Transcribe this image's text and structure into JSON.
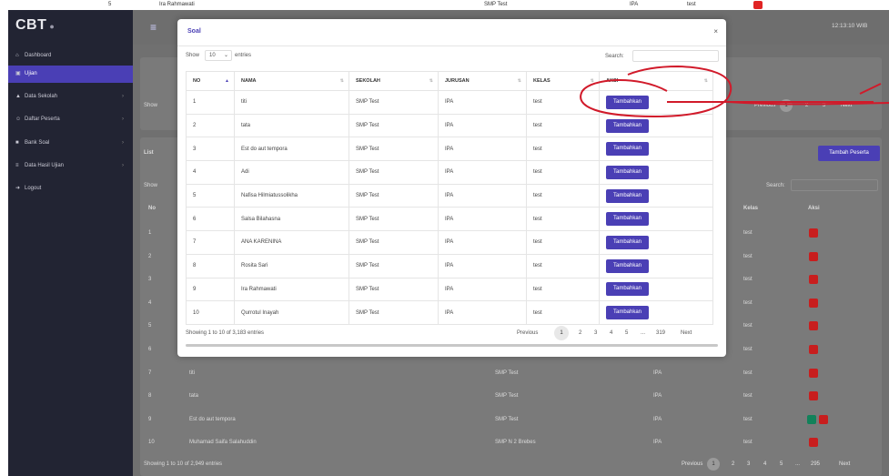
{
  "top_strip": {
    "no": "5",
    "name": "Ira Rahmawati",
    "school": "SMP Test",
    "major": "IPA",
    "class": "test"
  },
  "app": {
    "logo": "CBT",
    "time": "12:13:10 WIB"
  },
  "sidebar": {
    "items": [
      {
        "label": "Dashboard",
        "icon": "home-icon"
      },
      {
        "label": "Ujian",
        "icon": "calendar-icon",
        "active": true
      },
      {
        "label": "Data Sekolah",
        "icon": "school-icon",
        "has_arrow": true
      },
      {
        "label": "Daftar Peserta",
        "icon": "user-icon",
        "has_arrow": true
      },
      {
        "label": "Bank Soal",
        "icon": "server-icon",
        "has_arrow": true
      },
      {
        "label": "Data Hasil Ujian",
        "icon": "list-icon",
        "has_arrow": true
      },
      {
        "label": "Logout",
        "icon": "logout-icon"
      }
    ]
  },
  "background": {
    "top_card": {
      "show": "Show",
      "pagination": [
        "Previous",
        "1",
        "2",
        "3",
        "Next"
      ]
    },
    "list_card": {
      "title": "List",
      "add_button": "Tambah Peserta",
      "show": "Show",
      "search": "Search:",
      "col_no": "No",
      "col_kelas": "Kelas",
      "col_aksi": "Aksi",
      "rows": [
        {
          "no": "1",
          "name": "",
          "school": "",
          "major": "",
          "kelas": "test",
          "green": false
        },
        {
          "no": "2",
          "name": "",
          "school": "",
          "major": "",
          "kelas": "test",
          "green": false
        },
        {
          "no": "3",
          "name": "",
          "school": "",
          "major": "",
          "kelas": "test",
          "green": false
        },
        {
          "no": "4",
          "name": "",
          "school": "",
          "major": "",
          "kelas": "test",
          "green": false
        },
        {
          "no": "5",
          "name": "",
          "school": "",
          "major": "",
          "kelas": "test",
          "green": false
        },
        {
          "no": "6",
          "name": "",
          "school": "",
          "major": "",
          "kelas": "test",
          "green": false
        },
        {
          "no": "7",
          "name": "titi",
          "school": "SMP Test",
          "major": "IPA",
          "kelas": "test",
          "green": false
        },
        {
          "no": "8",
          "name": "tata",
          "school": "SMP Test",
          "major": "IPA",
          "kelas": "test",
          "green": false
        },
        {
          "no": "9",
          "name": "Est do aut tempora",
          "school": "SMP Test",
          "major": "IPA",
          "kelas": "test",
          "green": true
        },
        {
          "no": "10",
          "name": "Muhamad Saifa Salahuddin",
          "school": "SMP N 2 Brebes",
          "major": "IPA",
          "kelas": "test",
          "green": false
        }
      ],
      "info": "Showing 1 to 10 of 2,949 entries",
      "pagination": [
        "Previous",
        "1",
        "2",
        "3",
        "4",
        "5",
        "...",
        "295",
        "Next"
      ]
    }
  },
  "modal": {
    "title": "Soal",
    "close": "×",
    "show_label": "Show",
    "show_value": "10",
    "entries_label": "entries",
    "search_label": "Search:",
    "search_value": "",
    "columns": [
      "NO",
      "NAMA",
      "SEKOLAH",
      "JURUSAN",
      "KELAS",
      "AKSI"
    ],
    "rows": [
      {
        "no": "1",
        "name": "titi",
        "school": "SMP Test",
        "major": "IPA",
        "kelas": "test",
        "action": "Tambahkan"
      },
      {
        "no": "2",
        "name": "tata",
        "school": "SMP Test",
        "major": "IPA",
        "kelas": "test",
        "action": "Tambahkan"
      },
      {
        "no": "3",
        "name": "Est do aut tempora",
        "school": "SMP Test",
        "major": "IPA",
        "kelas": "test",
        "action": "Tambahkan"
      },
      {
        "no": "4",
        "name": "Adi",
        "school": "SMP Test",
        "major": "IPA",
        "kelas": "test",
        "action": "Tambahkan"
      },
      {
        "no": "5",
        "name": "Nafisa Hilmiatussolikha",
        "school": "SMP Test",
        "major": "IPA",
        "kelas": "test",
        "action": "Tambahkan"
      },
      {
        "no": "6",
        "name": "Salsa Bilahasna",
        "school": "SMP Test",
        "major": "IPA",
        "kelas": "test",
        "action": "Tambahkan"
      },
      {
        "no": "7",
        "name": "ANA KARENINA",
        "school": "SMP Test",
        "major": "IPA",
        "kelas": "test",
        "action": "Tambahkan"
      },
      {
        "no": "8",
        "name": "Rosita Sari",
        "school": "SMP Test",
        "major": "IPA",
        "kelas": "test",
        "action": "Tambahkan"
      },
      {
        "no": "9",
        "name": "Ira Rahmawati",
        "school": "SMP Test",
        "major": "IPA",
        "kelas": "test",
        "action": "Tambahkan"
      },
      {
        "no": "10",
        "name": "Qurrotul Inayah",
        "school": "SMP Test",
        "major": "IPA",
        "kelas": "test",
        "action": "Tambahkan"
      }
    ],
    "info": "Showing 1 to 10 of 3,183 entries",
    "pagination": [
      "Previous",
      "1",
      "2",
      "3",
      "4",
      "5",
      "...",
      "319",
      "Next"
    ]
  },
  "colors": {
    "primary": "#4a3fb5",
    "danger": "#c81e1e",
    "success": "#12825a",
    "sidebar": "#222433",
    "annotation": "#d11a2a"
  }
}
